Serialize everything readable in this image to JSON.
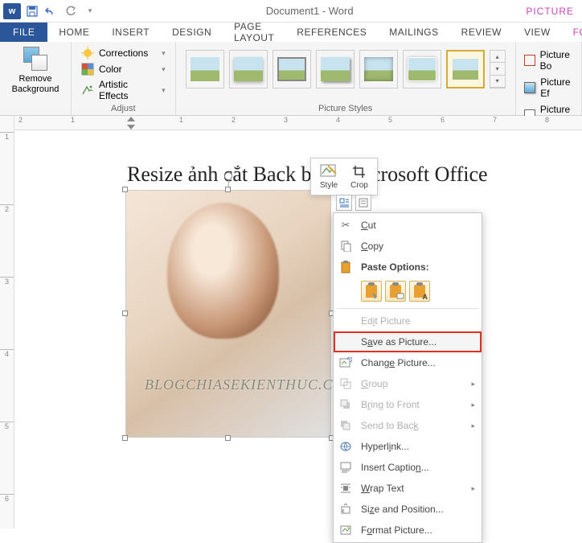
{
  "title": "Document1 - Word",
  "picture_tools": "PICTURE",
  "tabs": {
    "file": "FILE",
    "home": "HOME",
    "insert": "INSERT",
    "design": "DESIGN",
    "page_layout": "PAGE LAYOUT",
    "references": "REFERENCES",
    "mailings": "MAILINGS",
    "review": "REVIEW",
    "view": "VIEW",
    "format": "FORM"
  },
  "ribbon": {
    "remove_bg": "Remove\nBackground",
    "adjust": {
      "corrections": "Corrections",
      "color": "Color",
      "artistic": "Artistic Effects",
      "label": "Adjust"
    },
    "styles_label": "Picture Styles",
    "border": {
      "border": "Picture Bo",
      "effects": "Picture Ef",
      "layout": "Picture La"
    }
  },
  "ruler_h": [
    "2",
    "1",
    "1",
    "2",
    "3",
    "4",
    "5",
    "6",
    "7",
    "8",
    "9"
  ],
  "ruler_v": [
    "1",
    "2",
    "3",
    "4",
    "5",
    "6"
  ],
  "doc_title": "Resize ảnh cắt Back             bằng Microsoft Office",
  "watermark": "BLOGCHIASEKIENTHUC.COM",
  "mini_toolbar": {
    "style": "Style",
    "crop": "Crop"
  },
  "context_menu": {
    "cut": "Cut",
    "copy": "Copy",
    "paste_label": "Paste Options:",
    "edit_picture": "Edit Picture",
    "save_as_picture": "Save as Picture...",
    "change_picture": "Change Picture...",
    "group": "Group",
    "bring_front": "Bring to Front",
    "send_back": "Send to Back",
    "hyperlink": "Hyperlink...",
    "insert_caption": "Insert Caption...",
    "wrap_text": "Wrap Text",
    "size_position": "Size and Position...",
    "format_picture": "Format Picture..."
  }
}
